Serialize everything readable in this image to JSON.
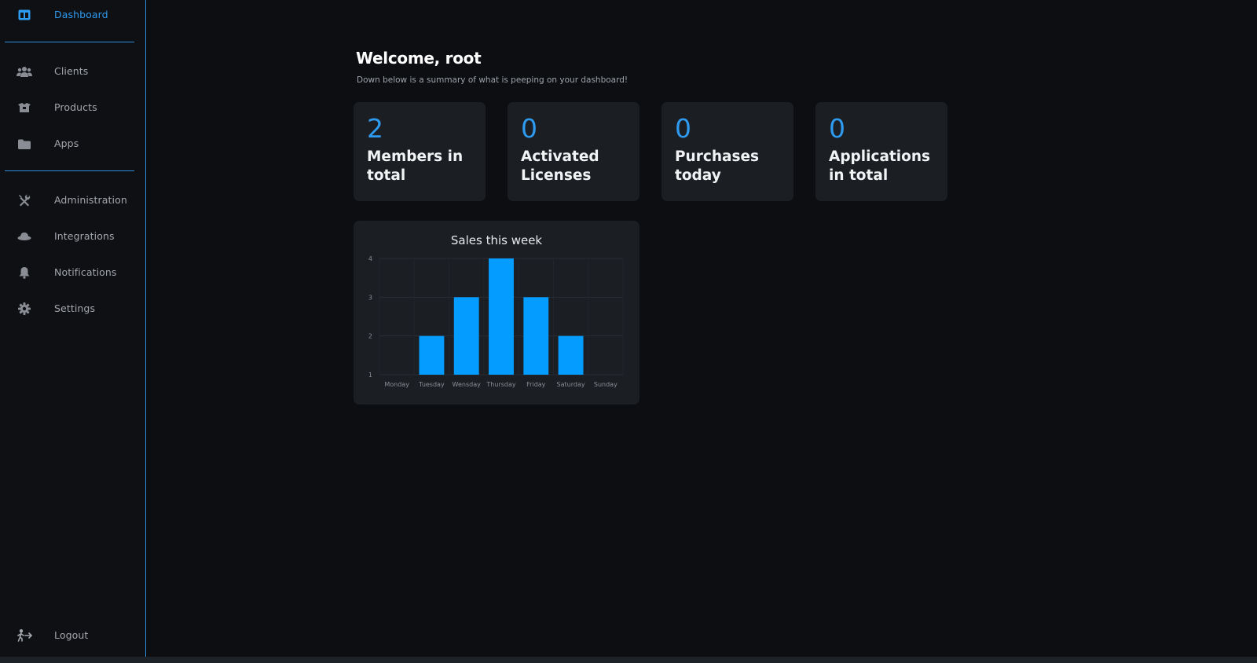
{
  "sidebar": {
    "items": [
      {
        "label": "Dashboard",
        "icon": "dashboard-icon",
        "active": true
      },
      {
        "label": "Clients",
        "icon": "users-icon",
        "active": false
      },
      {
        "label": "Products",
        "icon": "box-icon",
        "active": false
      },
      {
        "label": "Apps",
        "icon": "folder-icon",
        "active": false
      },
      {
        "label": "Administration",
        "icon": "tools-icon",
        "active": false
      },
      {
        "label": "Integrations",
        "icon": "hat-icon",
        "active": false
      },
      {
        "label": "Notifications",
        "icon": "bell-icon",
        "active": false
      },
      {
        "label": "Settings",
        "icon": "gear-icon",
        "active": false
      }
    ],
    "logout_label": "Logout"
  },
  "welcome": {
    "title": "Welcome, root",
    "subtitle": "Down below is a summary of what is peeping on your dashboard!"
  },
  "stats": [
    {
      "value": "2",
      "label": "Members in total"
    },
    {
      "value": "0",
      "label": "Activated Licenses"
    },
    {
      "value": "0",
      "label": "Purchases today"
    },
    {
      "value": "0",
      "label": "Applications in total"
    }
  ],
  "colors": {
    "accent": "#2e9bf0",
    "bar": "#049cff",
    "card": "#1b1e23",
    "background": "#0c0e12"
  },
  "chart_data": {
    "type": "bar",
    "title": "Sales this week",
    "categories": [
      "Monday",
      "Tuesday",
      "Wensday",
      "Thursday",
      "Friday",
      "Saturday",
      "Sunday"
    ],
    "values": [
      1,
      2,
      3,
      4,
      3,
      2,
      1
    ],
    "ylim": [
      1,
      4
    ],
    "yticks": [
      1,
      2,
      3,
      4
    ],
    "grid": true,
    "xlabel": "",
    "ylabel": ""
  }
}
